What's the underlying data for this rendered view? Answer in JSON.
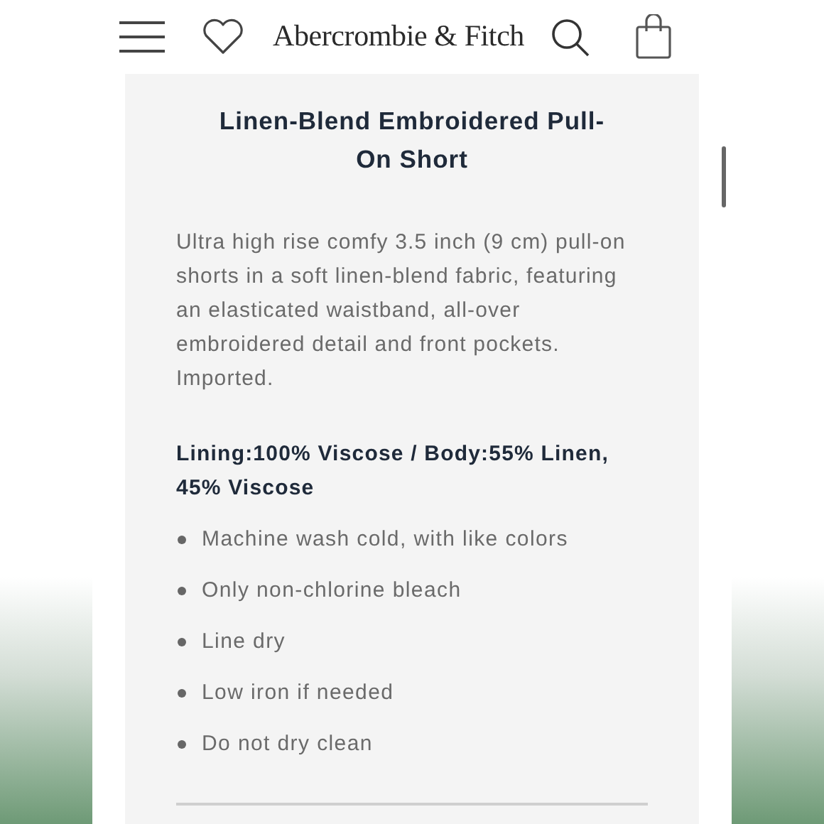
{
  "header": {
    "brand": "Abercrombie & Fitch"
  },
  "product": {
    "title": "Linen-Blend Embroidered Pull-On Short",
    "description": "Ultra high rise comfy 3.5 inch (9 cm) pull-on shorts in a soft linen-blend fabric, featuring an elasticated waistband, all-over embroidered detail and front pockets. Imported.",
    "composition": "Lining:100% Viscose / Body:55% Linen, 45% Viscose",
    "care": [
      "Machine wash cold, with like colors",
      "Only non-chlorine bleach",
      "Line dry",
      "Low iron if needed",
      "Do not dry clean"
    ]
  }
}
